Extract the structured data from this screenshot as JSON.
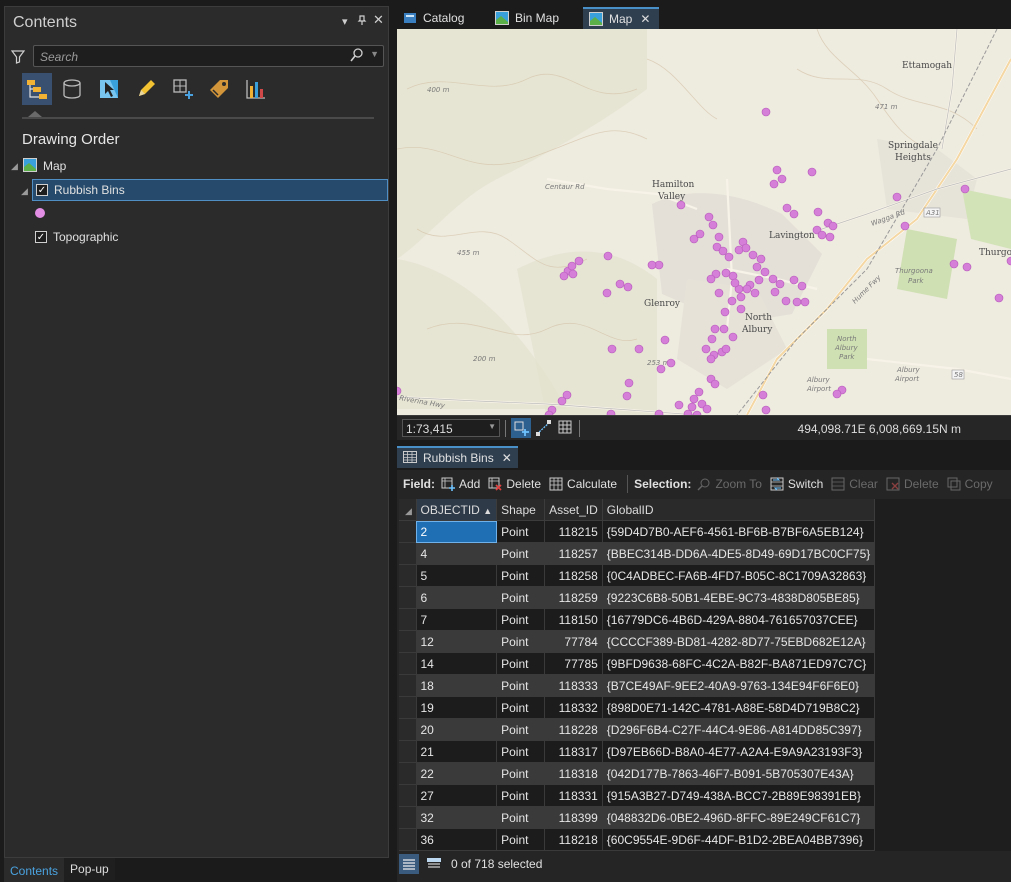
{
  "contents": {
    "title": "Contents",
    "search_placeholder": "Search",
    "drawing_order_label": "Drawing Order",
    "tree": {
      "map_label": "Map",
      "layers": [
        {
          "label": "Rubbish Bins",
          "checked": true,
          "selected": true,
          "symbol_color": "#e38ee5"
        },
        {
          "label": "Topographic",
          "checked": true,
          "selected": false
        }
      ]
    },
    "toolbar_icons": [
      "list-by-drawing-order-icon",
      "list-by-source-icon",
      "list-by-selection-icon",
      "list-by-editing-icon",
      "list-by-snapping-icon",
      "list-by-labeling-icon",
      "list-by-charts-icon"
    ],
    "bottom_tabs": [
      "Contents",
      "Pop-up"
    ]
  },
  "doc_tabs": [
    {
      "label": "Catalog",
      "active": false,
      "closable": false
    },
    {
      "label": "Bin Map",
      "active": false,
      "closable": false
    },
    {
      "label": "Map",
      "active": true,
      "closable": true
    }
  ],
  "map": {
    "scale": "1:73,415",
    "coordinates": "494,098.71E 6,008,669.15N m",
    "labels": {
      "ettamogah": "Ettamogah",
      "springdale1": "Springdale",
      "springdale2": "Heights",
      "hamilton1": "Hamilton",
      "hamilton2": "Valley",
      "lavington": "Lavington",
      "glenroy": "Glenroy",
      "north1": "North",
      "north2": "Albury",
      "thurgoona1": "Thurgoona",
      "thurgoona2": "Park",
      "thurgoona_edge": "Thurgo",
      "northalbury_park1": "North",
      "northalbury_park2": "Albury",
      "northalbury_park3": "Park",
      "albury_airport1": "Albury",
      "albury_airport2": "Airport",
      "albury_airport_b1": "Albury",
      "albury_airport_b2": "Airport",
      "centaur": "Centaur Rd",
      "riverina": "Riverina Hwy",
      "wagga": "Wagga Rd",
      "hume": "Hume Fwy",
      "e400": "400 m",
      "e455": "455 m",
      "e253": "253 m",
      "e200": "200 m",
      "e471": "471 m",
      "a31": "A31",
      "r58": "58"
    },
    "poi_color": "#d57fd8"
  },
  "attribute_table": {
    "tab_label": "Rubbish Bins",
    "toolbar": {
      "field_label": "Field:",
      "add": "Add",
      "delete": "Delete",
      "calculate": "Calculate",
      "selection_label": "Selection:",
      "zoom_to": "Zoom To",
      "switch": "Switch",
      "clear": "Clear",
      "delete_sel": "Delete",
      "copy": "Copy"
    },
    "columns": [
      "OBJECTID",
      "Shape",
      "Asset_ID",
      "GlobalID"
    ],
    "rows": [
      [
        "2",
        "Point",
        "118215",
        "{59D4D7B0-AEF6-4561-BF6B-B7BF6A5EB124}"
      ],
      [
        "4",
        "Point",
        "118257",
        "{BBEC314B-DD6A-4DE5-8D49-69D17BC0CF75}"
      ],
      [
        "5",
        "Point",
        "118258",
        "{0C4ADBEC-FA6B-4FD7-B05C-8C1709A32863}"
      ],
      [
        "6",
        "Point",
        "118259",
        "{9223C6B8-50B1-4EBE-9C73-4838D805BE85}"
      ],
      [
        "7",
        "Point",
        "118150",
        "{16779DC6-4B6D-429A-8804-761657037CEE}"
      ],
      [
        "12",
        "Point",
        "77784",
        "{CCCCF389-BD81-4282-8D77-75EBD682E12A}"
      ],
      [
        "14",
        "Point",
        "77785",
        "{9BFD9638-68FC-4C2A-B82F-BA871ED97C7C}"
      ],
      [
        "18",
        "Point",
        "118333",
        "{B7CE49AF-9EE2-40A9-9763-134E94F6F6E0}"
      ],
      [
        "19",
        "Point",
        "118332",
        "{898D0E71-142C-4781-A88E-58D4D719B8C2}"
      ],
      [
        "20",
        "Point",
        "118228",
        "{D296F6B4-C27F-44C4-9E86-A814DD85C397}"
      ],
      [
        "21",
        "Point",
        "118317",
        "{D97EB66D-B8A0-4E77-A2A4-E9A9A23193F3}"
      ],
      [
        "22",
        "Point",
        "118318",
        "{042D177B-7863-46F7-B091-5B705307E43A}"
      ],
      [
        "27",
        "Point",
        "118331",
        "{915A3B27-D749-438A-BCC7-2B89E98391EB}"
      ],
      [
        "32",
        "Point",
        "118399",
        "{048832D6-0BE2-496D-8FFC-89E249CF61C7}"
      ],
      [
        "36",
        "Point",
        "118218",
        "{60C9554E-9D6F-44DF-B1D2-2BEA04BB7396}"
      ]
    ],
    "status": "0 of 718 selected"
  }
}
